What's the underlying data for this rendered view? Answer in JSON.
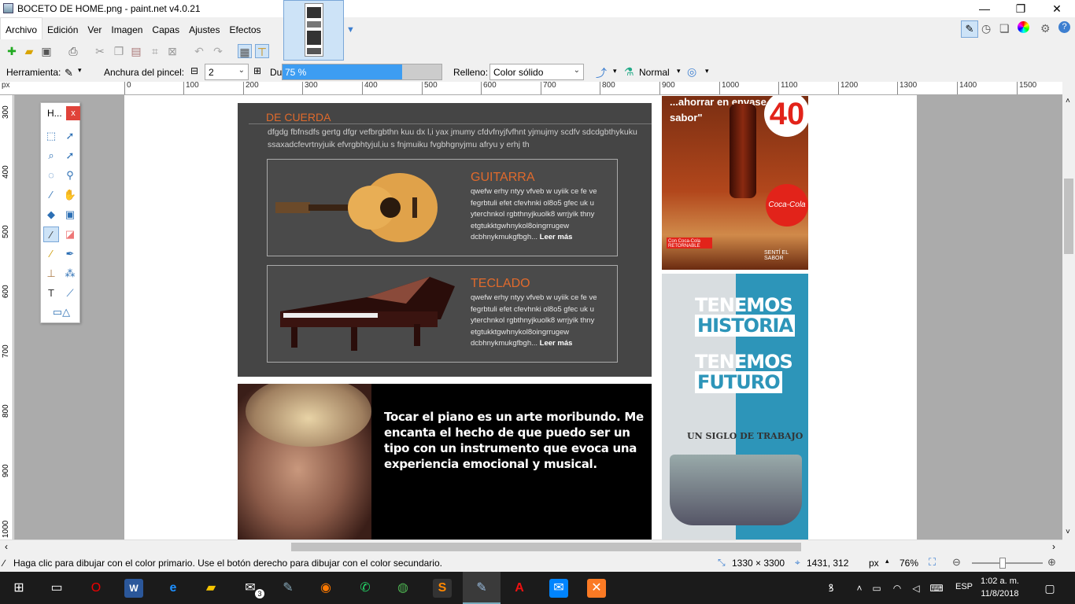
{
  "window": {
    "title": "BOCETO DE HOME.png - paint.net v4.0.21",
    "controls": [
      "—",
      "❐",
      "✕"
    ]
  },
  "menu": [
    "Archivo",
    "Edición",
    "Ver",
    "Imagen",
    "Capas",
    "Ajustes",
    "Efectos"
  ],
  "toolbar2": {
    "tool_label": "Herramienta:",
    "brush_width_label": "Anchura del pincel:",
    "brush_width_value": "2",
    "hardness_label": "Dureza:",
    "hardness_value": "75 %",
    "hardness_fraction": 0.75,
    "fill_label": "Relleno:",
    "fill_value": "Color sólido",
    "blend_mode": "Normal"
  },
  "ruler": {
    "unit": "px",
    "h_ticks": [
      "0",
      "100",
      "200",
      "300",
      "400",
      "500",
      "600",
      "700",
      "800",
      "900",
      "1000",
      "1100",
      "1200",
      "1300",
      "1400",
      "1500"
    ],
    "v_ticks": [
      "300",
      "400",
      "500",
      "600",
      "700",
      "800",
      "900",
      "1000"
    ]
  },
  "tools_window": {
    "title": "H...",
    "close": "x"
  },
  "canvas": {
    "section_heading": "DE CUERDA",
    "intro_text": "dfgdg fbfnsdfs gertg dfgr vefbrgbthn kuu dx l,i yax jmumy cfdvfnyjfvfhnt yjmujmy scdfv sdcdgbthykuku ssaxadcfevrtnyjuik efvrgbhtyjul,iu s fnjmuiku fvgbhgnyjmu afryu y erhj th",
    "cards": [
      {
        "title": "GUITARRA",
        "body": "qwefw erhy ntyy  vfveb w uyiik ce fe ve fegrbtuli efet cfevhnki ol8o5 gfec uk u yterchnkol rgbthnyjkuolk8 wrrjyik thny etgtukktgwhnykol8oingrrugew dcbhnykmukgfbgh...",
        "more": "Leer más"
      },
      {
        "title": "TECLADO",
        "body": "qwefw erhy ntyy  vfveb w uyiik ce fe ve fegrbtuli efet cfevhnki ol8o5 gfec uk u yterchnkol rgbthnyjkuolk8 wrrjyik thny etgtukktgwhnykol8oingrrugew dcbhnykmukgfbgh...",
        "more": "Leer más"
      }
    ],
    "quote": "Tocar el piano es un arte moribundo. Me encanta el hecho de que puedo ser un tipo con un instrumento que evoca una experiencia emocional y musical.",
    "ad1": {
      "text": "...ahorrar en envase que en sabor\"",
      "number": "40",
      "brand": "Coca-Cola",
      "tag": "Con Coca-Cola RETORNABLE",
      "slogan": "SENTÍ EL SABOR"
    },
    "ad2": {
      "line1": "TENEMOS",
      "line2": "HISTORIA",
      "line3": "TENEMOS",
      "line4": "FUTURO",
      "banner": "UN SIGLO DE TRABAJO"
    }
  },
  "statusbar": {
    "hint": "Haga clic para dibujar con el color primario. Use el botón derecho para dibujar con el color secundario.",
    "image_size": "1330 × 3300",
    "cursor_pos": "1431, 312",
    "unit": "px",
    "zoom": "76%"
  },
  "taskbar": {
    "language": "ESP",
    "time": "1:02 a. m.",
    "date": "11/8/2018",
    "mail_badge": "3"
  },
  "colors": {
    "accent_orange": "#e06a2c",
    "hardness_fill": "#3d9df2",
    "canvas_bg": "#ababab"
  }
}
